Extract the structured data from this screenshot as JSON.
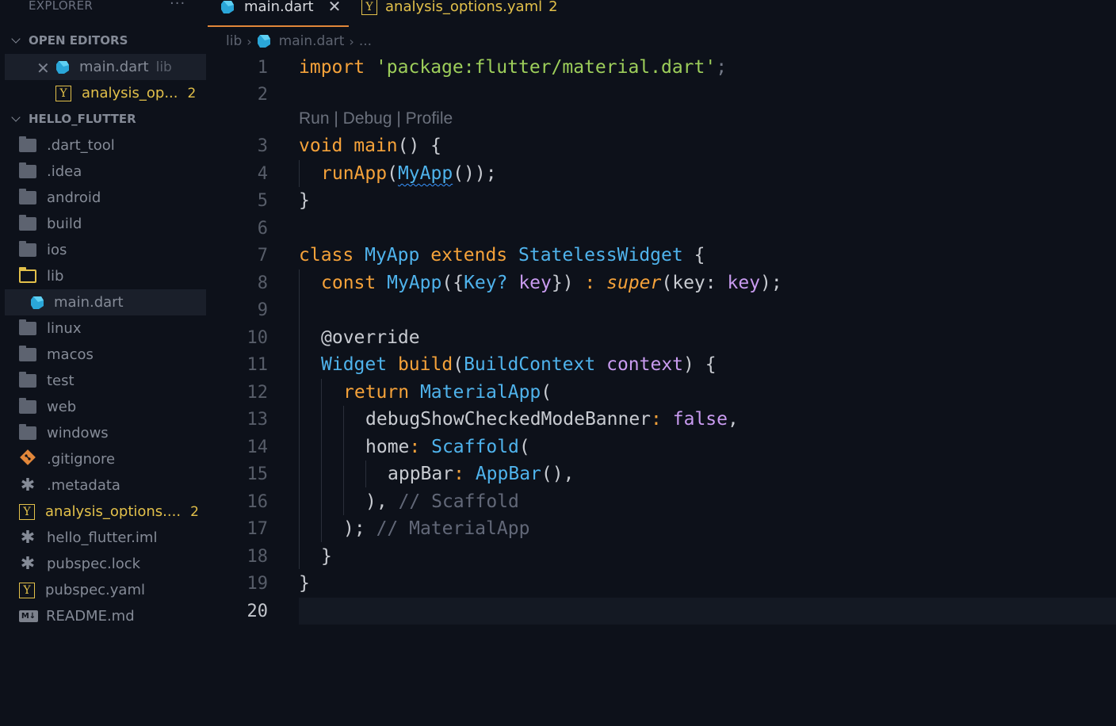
{
  "sidebar": {
    "title": "EXPLORER",
    "more": "···",
    "open_editors": {
      "header": "OPEN EDITORS",
      "items": [
        {
          "label": "main.dart",
          "sub": "lib"
        },
        {
          "label": "analysis_op...",
          "badge": "2"
        }
      ]
    },
    "project": {
      "header": "HELLO_FLUTTER",
      "items": [
        {
          "label": ".dart_tool"
        },
        {
          "label": ".idea"
        },
        {
          "label": "android"
        },
        {
          "label": "build"
        },
        {
          "label": "ios"
        },
        {
          "label": "lib"
        },
        {
          "label": "main.dart"
        },
        {
          "label": "linux"
        },
        {
          "label": "macos"
        },
        {
          "label": "test"
        },
        {
          "label": "web"
        },
        {
          "label": "windows"
        },
        {
          "label": ".gitignore"
        },
        {
          "label": ".metadata"
        },
        {
          "label": "analysis_options....",
          "badge": "2"
        },
        {
          "label": "hello_flutter.iml"
        },
        {
          "label": "pubspec.lock"
        },
        {
          "label": "pubspec.yaml"
        },
        {
          "label": "README.md"
        }
      ]
    }
  },
  "tabs": [
    {
      "label": "main.dart",
      "close": "✕"
    },
    {
      "label": "analysis_options.yaml",
      "badge": "2"
    }
  ],
  "breadcrumb": {
    "folder": "lib",
    "file": "main.dart",
    "more": "..."
  },
  "codelens": "Run | Debug | Profile",
  "line_numbers": [
    "1",
    "2",
    "3",
    "4",
    "5",
    "6",
    "7",
    "8",
    "9",
    "10",
    "11",
    "12",
    "13",
    "14",
    "15",
    "16",
    "17",
    "18",
    "19",
    "20"
  ],
  "code": {
    "l1": {
      "kw": "import",
      "str": "'package:flutter/material.dart'",
      "end": ";"
    },
    "l3": {
      "kw": "void",
      "fn": "main",
      "rest": "() {"
    },
    "l4": {
      "fn": "runApp",
      "open": "(",
      "cls": "MyApp",
      "close": "());"
    },
    "l5": "}",
    "l7": {
      "kw1": "class",
      "cls1": "MyApp",
      "kw2": "extends",
      "cls2": "StatelessWidget",
      "end": "{"
    },
    "l8": {
      "kw": "const",
      "cls": "MyApp",
      "p1": "({",
      "type": "Key?",
      "param": "key",
      "p2": "})",
      "colon": ":",
      "sup": "super",
      "p3": "(key:",
      "param2": "key",
      "p4": ");"
    },
    "l10": "@override",
    "l11": {
      "cls1": "Widget",
      "fn": "build",
      "open": "(",
      "cls2": "BuildContext",
      "param": "context",
      "end": ") {"
    },
    "l12": {
      "kw": "return",
      "cls": "MaterialApp",
      "end": "("
    },
    "l13": {
      "prop": "debugShowCheckedModeBanner",
      "colon": ":",
      "val": "false",
      "end": ","
    },
    "l14": {
      "prop": "home",
      "colon": ":",
      "cls": "Scaffold",
      "end": "("
    },
    "l15": {
      "prop": "appBar",
      "colon": ":",
      "cls": "AppBar",
      "end": "(),"
    },
    "l16": {
      "code": "),",
      "cmt": "// Scaffold"
    },
    "l17": {
      "code": ");",
      "cmt": "// MaterialApp"
    },
    "l18": "}",
    "l19": "}"
  },
  "colors": {
    "keyword": "#f5a23a",
    "string": "#9dce5a",
    "class": "#4fb3ec",
    "param": "#c99bf0",
    "comment": "#626878",
    "accent_tab": "#e2873a",
    "warning_yellow": "#e2c04a"
  }
}
